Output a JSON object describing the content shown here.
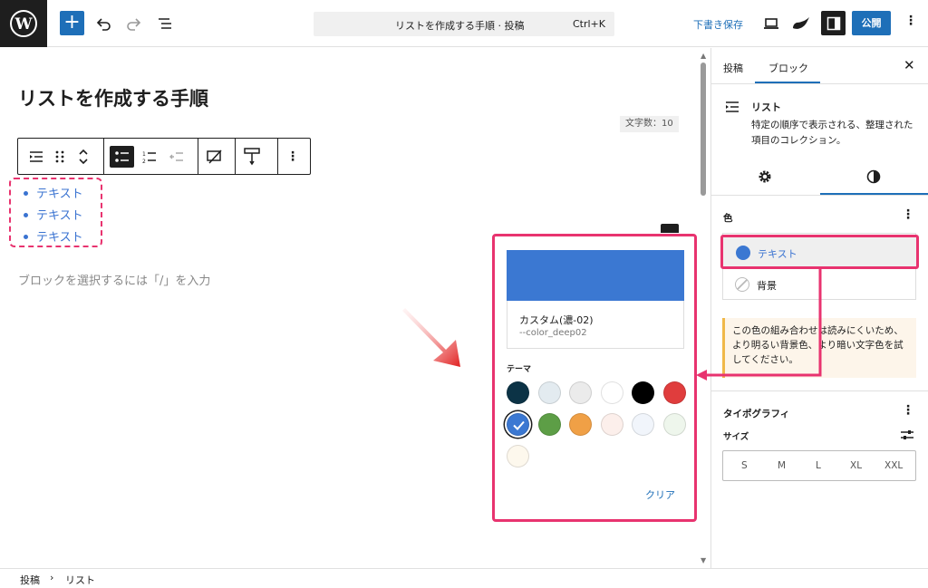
{
  "topbar": {
    "command_title": "リストを作成する手順 · 投稿",
    "command_shortcut": "Ctrl+K",
    "draft_save": "下書き保存",
    "publish": "公開"
  },
  "editor": {
    "post_title": "リストを作成する手順",
    "char_count": "文字数：10",
    "list_items": [
      "テキスト",
      "テキスト",
      "テキスト"
    ],
    "placeholder": "ブロックを選択するには「/」を入力"
  },
  "popover": {
    "selected_color": "#3b78d2",
    "swatch_name": "カスタム(濃-02)",
    "swatch_var": "--color_deep02",
    "theme_label": "テーマ",
    "theme_colors": [
      "#0c3346",
      "#e3ebf0",
      "#ebebeb",
      "#ffffff",
      "#000000",
      "#e03d3d",
      "#3b78d2",
      "#5d9e46",
      "#f0a046",
      "#fcefeb",
      "#f1f5fb",
      "#eef6ec",
      "#fdf8ed"
    ],
    "clear": "クリア"
  },
  "sidebar": {
    "tabs": [
      "投稿",
      "ブロック"
    ],
    "block_name": "リスト",
    "block_desc": "特定の順序で表示される、整理された項目のコレクション。",
    "color_heading": "色",
    "text_label": "テキスト",
    "background_label": "背景",
    "warning": "この色の組み合わせは読みにくいため、より明るい背景色、より暗い文字色を試してください。",
    "typography_heading": "タイポグラフィ",
    "size_label": "サイズ",
    "sizes": [
      "S",
      "M",
      "L",
      "XL",
      "XXL"
    ]
  },
  "footer": {
    "crumbs": [
      "投稿",
      "リスト"
    ]
  },
  "colors": {
    "accent": "#1e6fb8",
    "highlight": "#e8336f"
  }
}
